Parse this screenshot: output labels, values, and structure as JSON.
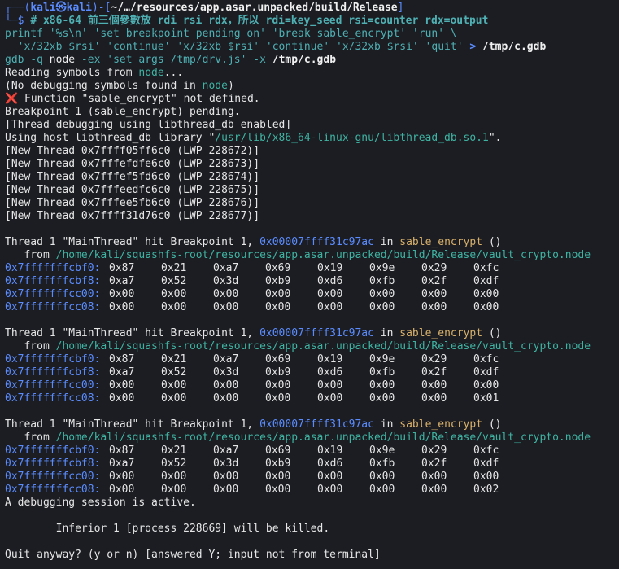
{
  "prompt": {
    "box_top": "┌──(",
    "user": "kali",
    "at": "㉿",
    "host": "kali",
    "sep": ")-[",
    "cwd": "~/…/resources/app.asar.unpacked/build/Release",
    "close": "]",
    "box_bottom": "└─$ ",
    "comment": "# x86-64 前三個參數放 rdi rsi rdx，所以 rdi=key_seed rsi=counter rdx=output"
  },
  "cmd1": {
    "line1_printf": "printf",
    "line1_args": " '%s\\n' 'set breakpoint pending on' 'break sable_encrypt' 'run' \\",
    "line2_args": "  'x/32xb $rsi' 'continue' 'x/32xb $rsi' 'continue' 'x/32xb $rsi' 'quit' ",
    "line2_redir": "> ",
    "line2_file": "/tmp/c.gdb"
  },
  "cmd2": {
    "prog": "gdb",
    "opt1": " -q ",
    "arg1": "node",
    "opt2": " -ex ",
    "arg2": "'set args /tmp/drv.js'",
    "opt3": " -x ",
    "arg3": "/tmp/c.gdb"
  },
  "output": {
    "reading": "Reading symbols from ",
    "reading_node": "node",
    "reading_end": "...",
    "nodebug_1": "(No debugging symbols found in ",
    "nodebug_node": "node",
    "nodebug_2": ")",
    "x_mark": "❌",
    "func_undef": " Function \"sable_encrypt\" not defined.",
    "bp_pending": "Breakpoint 1 (sable_encrypt) pending.",
    "thread_debug": "[Thread debugging using libthread_db enabled]",
    "using_host_1": "Using host libthread_db library \"",
    "using_host_path": "/usr/lib/x86_64-linux-gnu/libthread_db.so.1",
    "using_host_2": "\".",
    "new_threads": [
      "[New Thread 0x7ffff05ff6c0 (LWP 228672)]",
      "[New Thread 0x7fffefdfe6c0 (LWP 228673)]",
      "[New Thread 0x7fffef5fd6c0 (LWP 228674)]",
      "[New Thread 0x7fffeedfc6c0 (LWP 228675)]",
      "[New Thread 0x7fffee5fb6c0 (LWP 228676)]",
      "[New Thread 0x7ffff31d76c0 (LWP 228677)]"
    ]
  },
  "hits": [
    {
      "hit_prefix": "Thread 1 \"MainThread\" hit Breakpoint 1, ",
      "hit_addr": "0x00007ffff31c97ac",
      "hit_in": " in ",
      "hit_func": "sable_encrypt",
      "hit_end": " ()",
      "from_label": "   from ",
      "from_path": "/home/kali/squashfs-root/resources/app.asar.unpacked/build/Release/vault_crypto.node",
      "rows": [
        {
          "addr": "0x7fffffffcbf0:",
          "vals": [
            "0x87",
            "0x21",
            "0xa7",
            "0x69",
            "0x19",
            "0x9e",
            "0x29",
            "0xfc"
          ]
        },
        {
          "addr": "0x7fffffffcbf8:",
          "vals": [
            "0xa7",
            "0x52",
            "0x3d",
            "0xb9",
            "0xd6",
            "0xfb",
            "0x2f",
            "0xdf"
          ]
        },
        {
          "addr": "0x7fffffffcc00:",
          "vals": [
            "0x00",
            "0x00",
            "0x00",
            "0x00",
            "0x00",
            "0x00",
            "0x00",
            "0x00"
          ]
        },
        {
          "addr": "0x7fffffffcc08:",
          "vals": [
            "0x00",
            "0x00",
            "0x00",
            "0x00",
            "0x00",
            "0x00",
            "0x00",
            "0x00"
          ]
        }
      ]
    },
    {
      "hit_prefix": "Thread 1 \"MainThread\" hit Breakpoint 1, ",
      "hit_addr": "0x00007ffff31c97ac",
      "hit_in": " in ",
      "hit_func": "sable_encrypt",
      "hit_end": " ()",
      "from_label": "   from ",
      "from_path": "/home/kali/squashfs-root/resources/app.asar.unpacked/build/Release/vault_crypto.node",
      "rows": [
        {
          "addr": "0x7fffffffcbf0:",
          "vals": [
            "0x87",
            "0x21",
            "0xa7",
            "0x69",
            "0x19",
            "0x9e",
            "0x29",
            "0xfc"
          ]
        },
        {
          "addr": "0x7fffffffcbf8:",
          "vals": [
            "0xa7",
            "0x52",
            "0x3d",
            "0xb9",
            "0xd6",
            "0xfb",
            "0x2f",
            "0xdf"
          ]
        },
        {
          "addr": "0x7fffffffcc00:",
          "vals": [
            "0x00",
            "0x00",
            "0x00",
            "0x00",
            "0x00",
            "0x00",
            "0x00",
            "0x00"
          ]
        },
        {
          "addr": "0x7fffffffcc08:",
          "vals": [
            "0x00",
            "0x00",
            "0x00",
            "0x00",
            "0x00",
            "0x00",
            "0x00",
            "0x01"
          ]
        }
      ]
    },
    {
      "hit_prefix": "Thread 1 \"MainThread\" hit Breakpoint 1, ",
      "hit_addr": "0x00007ffff31c97ac",
      "hit_in": " in ",
      "hit_func": "sable_encrypt",
      "hit_end": " ()",
      "from_label": "   from ",
      "from_path": "/home/kali/squashfs-root/resources/app.asar.unpacked/build/Release/vault_crypto.node",
      "rows": [
        {
          "addr": "0x7fffffffcbf0:",
          "vals": [
            "0x87",
            "0x21",
            "0xa7",
            "0x69",
            "0x19",
            "0x9e",
            "0x29",
            "0xfc"
          ]
        },
        {
          "addr": "0x7fffffffcbf8:",
          "vals": [
            "0xa7",
            "0x52",
            "0x3d",
            "0xb9",
            "0xd6",
            "0xfb",
            "0x2f",
            "0xdf"
          ]
        },
        {
          "addr": "0x7fffffffcc00:",
          "vals": [
            "0x00",
            "0x00",
            "0x00",
            "0x00",
            "0x00",
            "0x00",
            "0x00",
            "0x00"
          ]
        },
        {
          "addr": "0x7fffffffcc08:",
          "vals": [
            "0x00",
            "0x00",
            "0x00",
            "0x00",
            "0x00",
            "0x00",
            "0x00",
            "0x02"
          ]
        }
      ]
    }
  ],
  "footer": {
    "active": "A debugging session is active.",
    "inferior": "        Inferior 1 [process 228669] will be killed.",
    "quit": "Quit anyway? (y or n) [answered Y; input not from terminal]"
  },
  "colors": {
    "background": "#1b1d22",
    "prompt_blue": "#5b8cff",
    "command_cyan": "#4fb0b3",
    "path_teal": "#3fb3a2",
    "function_yellow": "#d9b16b",
    "error_red": "#e24a4a"
  }
}
